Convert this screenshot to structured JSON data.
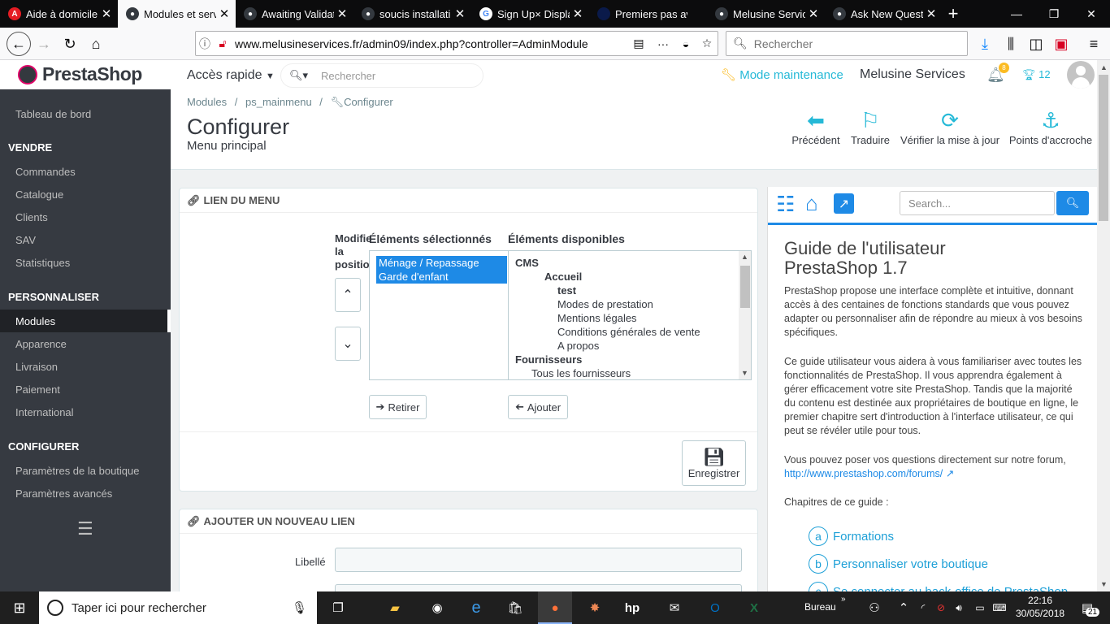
{
  "browser": {
    "tabs": [
      {
        "title": "Aide à domicile",
        "active": false
      },
      {
        "title": "Modules et serv",
        "active": true
      },
      {
        "title": "Awaiting Validat",
        "active": false
      },
      {
        "title": "soucis installati",
        "active": false
      },
      {
        "title": "Sign Up× Displa",
        "active": false
      },
      {
        "title": "Premiers pas av",
        "active": false
      },
      {
        "title": "Melusine Servic",
        "active": false
      },
      {
        "title": "Ask New Questi",
        "active": false
      }
    ],
    "url": "www.melusineservices.fr/admin09/index.php?controller=AdminModule",
    "search_placeholder": "Rechercher"
  },
  "header": {
    "logo": "PrestaShop",
    "quick_access": "Accès rapide",
    "search_placeholder": "Rechercher",
    "maintenance": "Mode maintenance",
    "shop_name": "Melusine Services",
    "notif_count": "8",
    "trophy_count": "12"
  },
  "sidebar": {
    "dashboard": "Tableau de bord",
    "sections": [
      {
        "title": "VENDRE",
        "items": [
          "Commandes",
          "Catalogue",
          "Clients",
          "SAV",
          "Statistiques"
        ]
      },
      {
        "title": "PERSONNALISER",
        "items": [
          "Modules",
          "Apparence",
          "Livraison",
          "Paiement",
          "International"
        ]
      },
      {
        "title": "CONFIGURER",
        "items": [
          "Paramètres de la boutique",
          "Paramètres avancés"
        ]
      }
    ],
    "active_item": "Modules"
  },
  "page": {
    "breadcrumb": [
      "Modules",
      "ps_mainmenu",
      "Configurer"
    ],
    "title": "Configurer",
    "subtitle": "Menu principal",
    "toolbar": [
      "Précédent",
      "Traduire",
      "Vérifier la mise à jour",
      "Points d'accroche"
    ]
  },
  "menu_panel": {
    "heading": "LIEN DU MENU",
    "modify_label": "Modifier la position",
    "selected_label": "Éléments sélectionnés",
    "available_label": "Éléments disponibles",
    "selected_items": [
      "Ménage / Repassage",
      "Garde d'enfant"
    ],
    "available_items": {
      "cms": "CMS",
      "accueil": "Accueil",
      "test": "test",
      "pages": [
        "Modes de prestation",
        "Mentions légales",
        "Conditions générales de vente",
        "A propos"
      ],
      "suppliers": "Fournisseurs",
      "all_suppliers": "Tous les fournisseurs"
    },
    "remove_button": "Retirer",
    "add_button": "Ajouter",
    "save_button": "Enregistrer"
  },
  "new_link_panel": {
    "heading": "AJOUTER UN NOUVEAU LIEN",
    "label_field": "Libellé"
  },
  "help": {
    "search_placeholder": "Search...",
    "title_line1": "Guide de l'utilisateur",
    "title_line2": "PrestaShop 1.7",
    "p1": "PrestaShop propose une interface complète et intuitive, donnant accès à des centaines de fonctions standards que vous pouvez adapter ou personnaliser afin de répondre au mieux à vos besoins spécifiques.",
    "p2": "Ce guide utilisateur vous aidera à vous familiariser avec toutes les fonctionnalités de PrestaShop. Il vous apprendra également à gérer efficacement votre site PrestaShop. Tandis que la majorité du contenu est destinée aux propriétaires de boutique en ligne, le premier chapitre sert d'introduction à l'interface utilisateur, ce qui peut se révéler utile pour tous.",
    "p3": "Vous pouvez poser vos questions directement sur notre forum,",
    "forum_link": "http://www.prestashop.com/forums/",
    "chapters_label": "Chapitres de ce guide :",
    "chapters": [
      {
        "letter": "a",
        "label": "Formations"
      },
      {
        "letter": "b",
        "label": "Personnaliser votre boutique"
      },
      {
        "letter": "c",
        "label": "Se connecter au back-office de PrestaShop"
      }
    ]
  },
  "taskbar": {
    "search_placeholder": "Taper ici pour rechercher",
    "desktop_label": "Bureau",
    "time": "22:16",
    "date": "30/05/2018",
    "notif_count": "21"
  },
  "colors": {
    "accent": "#25b9d7",
    "sidebar": "#363a41",
    "selected": "#1e8ae6"
  }
}
